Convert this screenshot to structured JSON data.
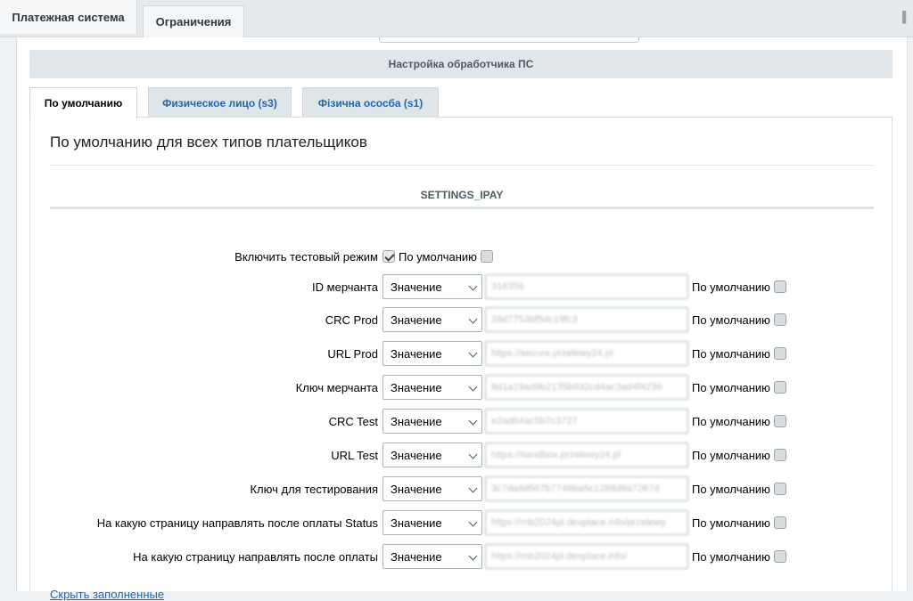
{
  "top_tabs": [
    {
      "label": "Платежная система"
    },
    {
      "label": "Ограничения"
    }
  ],
  "section_header": "Настройка обработчика ПС",
  "sub_tabs": [
    {
      "label": "По умолчанию"
    },
    {
      "label": "Физическое лицо (s3)"
    },
    {
      "label": "Фізична ососба (s1)"
    }
  ],
  "payer_title": "По умолчанию для всех типов плательщиков",
  "group_title": "SETTINGS_IPAY",
  "test_mode": {
    "label": "Включить тестовый режим",
    "checked": true,
    "default_label": "По умолчанию"
  },
  "default_label": "По умолчанию",
  "select_value": "Значение",
  "rows": [
    {
      "label": "ID мерчанта",
      "value": "316356"
    },
    {
      "label": "CRC Prod",
      "value": "28d7753bf5dc19fc3"
    },
    {
      "label": "URL Prod",
      "value": "https://secure.przelewy24.pl"
    },
    {
      "label": "Ключ мерчанта",
      "value": "8d1a19ad9b2135b932cd4ac3ad4f4236"
    },
    {
      "label": "CRC Test",
      "value": "e2ad64ac5b7c3727"
    },
    {
      "label": "URL Test",
      "value": "https://sandbox.przelewy24.pl"
    },
    {
      "label": "Ключ для тестирования",
      "value": "3c7da9d567b7746ba5c1288d9a7267d"
    },
    {
      "label": "На какую страницу направлять после оплаты Status",
      "value": "https://mb2024pl.dexplace.info/przelewy"
    },
    {
      "label": "На какую страницу направлять после оплаты",
      "value": "https://mb2024pl.dexplace.info/"
    }
  ],
  "hide_link": "Скрыть заполненные"
}
